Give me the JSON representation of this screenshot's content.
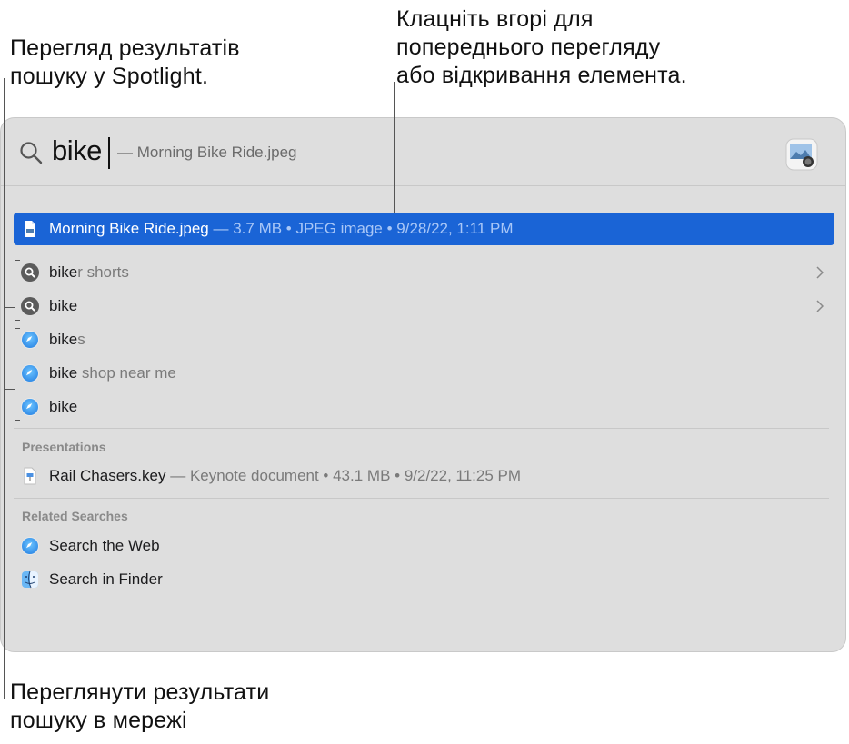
{
  "callouts": {
    "top_left": [
      "Перегляд результатів",
      "пошуку у Spotlight."
    ],
    "top_right": [
      "Клацніть вгорі для",
      "попереднього перегляду",
      "або відкривання елемента."
    ],
    "bottom_left": [
      "Переглянути результати",
      "пошуку в мережі"
    ]
  },
  "search": {
    "query": "bike",
    "suggestion": "— Morning Bike Ride.jpeg"
  },
  "top_hit": {
    "name": "Morning Bike Ride.jpeg",
    "details": " — 3.7 MB • JPEG image • 9/28/22, 1:11 PM"
  },
  "suggestions": [
    {
      "icon": "search-suggestion-icon",
      "typed": "bike",
      "rest": "r shorts",
      "chevron": true
    },
    {
      "icon": "search-suggestion-icon",
      "typed": "bike",
      "rest": "",
      "chevron": true
    },
    {
      "icon": "safari-icon",
      "typed": "bike",
      "rest": "s",
      "chevron": false
    },
    {
      "icon": "safari-icon",
      "typed": "bike",
      "rest": " shop near me",
      "chevron": false
    },
    {
      "icon": "safari-icon",
      "typed": "bike",
      "rest": "",
      "chevron": false
    }
  ],
  "presentations": {
    "header": "Presentations",
    "items": [
      {
        "name": "Rail Chasers.key",
        "details": " — Keynote document • 43.1 MB • 9/2/22, 11:25 PM"
      }
    ]
  },
  "related": {
    "header": "Related Searches",
    "items": [
      {
        "icon": "safari-icon",
        "label": "Search the Web"
      },
      {
        "icon": "finder-icon",
        "label": "Search in Finder"
      }
    ]
  },
  "colors": {
    "selection": "#1a64d6",
    "panel": "#dedede"
  }
}
